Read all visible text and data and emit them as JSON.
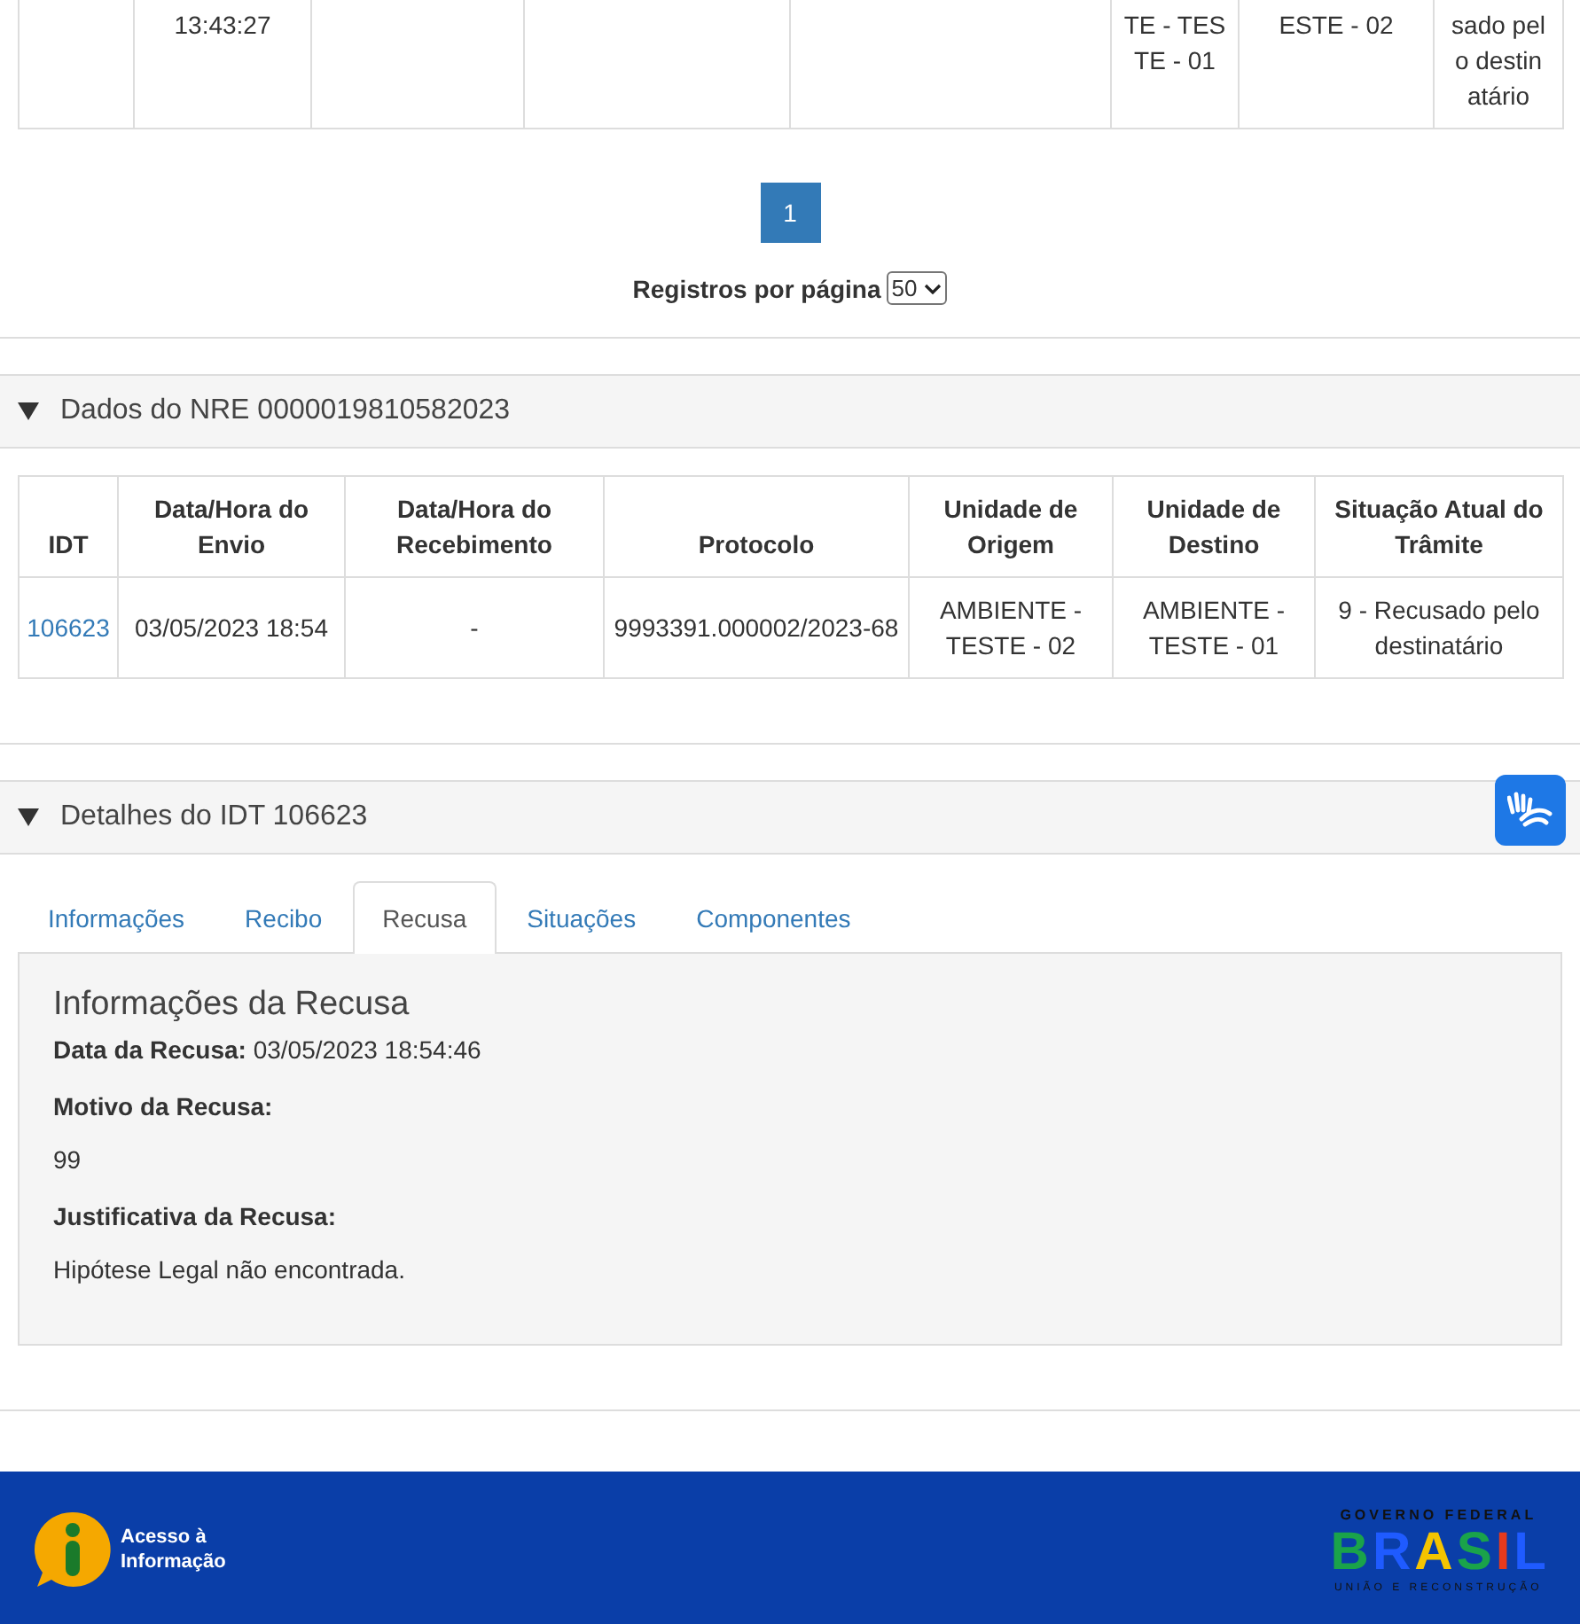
{
  "previous_table": {
    "rows": [
      {
        "cells": [
          null,
          [
            "13:43:27"
          ],
          null,
          null,
          null,
          [
            "TE - TES",
            "TE - 01"
          ],
          [
            "ESTE - 02"
          ],
          [
            "sado pel",
            "o destin",
            "atário"
          ]
        ]
      }
    ]
  },
  "pagination": {
    "pages": [
      {
        "label": "1",
        "selected": true
      }
    ],
    "per_page_label": "Registros por página",
    "per_page_value": "50"
  },
  "nre_section": {
    "title": "Dados do NRE 0000019810582023",
    "expanded": true,
    "columns": [
      "IDT",
      "Data/Hora do Envio",
      "Data/Hora do Recebimento",
      "Protocolo",
      "Unidade de Origem",
      "Unidade de Destino",
      "Situação Atual do Trâmite"
    ],
    "rows": [
      {
        "cells": [
          "106623",
          "03/05/2023 18:54",
          "-",
          "9993391.000002/2023-68",
          "AMBIENTE - TESTE - 02",
          "AMBIENTE - TESTE - 01",
          "9 - Recusado pelo destinatário"
        ]
      }
    ]
  },
  "details_section": {
    "title": "Detalhes do IDT 106623",
    "expanded": true,
    "tabs": [
      {
        "label": "Informações",
        "selected": false
      },
      {
        "label": "Recibo",
        "selected": false
      },
      {
        "label": "Recusa",
        "selected": true
      },
      {
        "label": "Situações",
        "selected": false
      },
      {
        "label": "Componentes",
        "selected": false
      }
    ],
    "panel": {
      "heading": "Informações da Recusa",
      "fields": [
        {
          "kind": "inline",
          "label": "Data da Recusa:",
          "value": "03/05/2023 18:54:46"
        },
        {
          "kind": "block",
          "label": "Motivo da Recusa:",
          "value": "99"
        },
        {
          "kind": "block",
          "label": "Justificativa da Recusa:",
          "value": "Hipótese Legal não encontrada."
        }
      ]
    }
  },
  "footer": {
    "access_info": "Acesso à Informação",
    "logo_top": "GOVERNO FEDERAL",
    "logo_main": "BRASIL",
    "logo_bottom": "UNIÃO E RECONSTRUÇÃO"
  }
}
